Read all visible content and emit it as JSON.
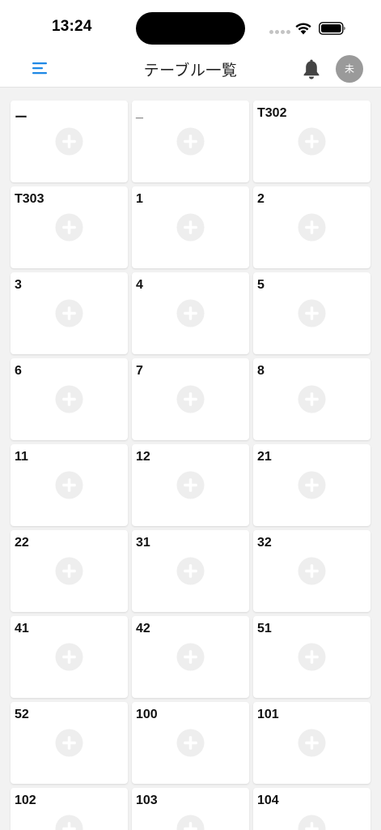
{
  "status_bar": {
    "time": "13:24"
  },
  "header": {
    "title": "テーブル一覧",
    "avatar_label": "未"
  },
  "icons": {
    "menu": "menu-icon",
    "bell": "bell-icon",
    "add": "plus-circle-icon",
    "wifi": "wifi-icon",
    "battery": "battery-icon"
  },
  "colors": {
    "accent": "#1e88e5",
    "avatar_bg": "#9a9a9a",
    "add_icon": "#eeeeee"
  },
  "tables": [
    {
      "name": "ー"
    },
    {
      "name": "_"
    },
    {
      "name": "T302"
    },
    {
      "name": "T303"
    },
    {
      "name": "1"
    },
    {
      "name": "2"
    },
    {
      "name": "3"
    },
    {
      "name": "4"
    },
    {
      "name": "5"
    },
    {
      "name": "6"
    },
    {
      "name": "7"
    },
    {
      "name": "8"
    },
    {
      "name": "11"
    },
    {
      "name": "12"
    },
    {
      "name": "21"
    },
    {
      "name": "22"
    },
    {
      "name": "31"
    },
    {
      "name": "32"
    },
    {
      "name": "41"
    },
    {
      "name": "42"
    },
    {
      "name": "51"
    },
    {
      "name": "52"
    },
    {
      "name": "100"
    },
    {
      "name": "101"
    },
    {
      "name": "102"
    },
    {
      "name": "103"
    },
    {
      "name": "104"
    }
  ]
}
